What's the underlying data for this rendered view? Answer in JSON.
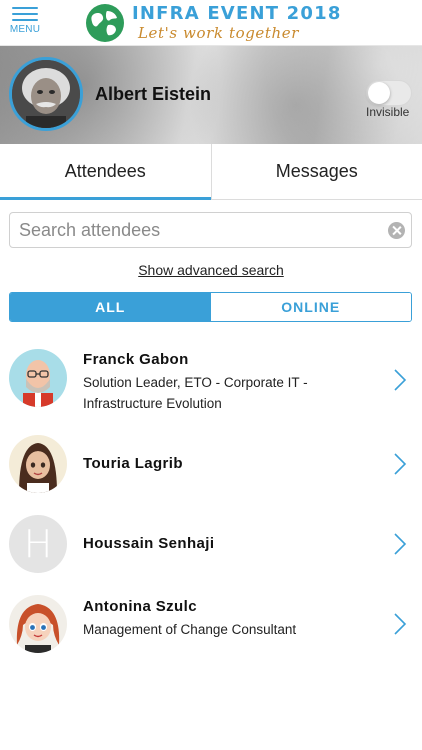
{
  "header": {
    "menu_label": "MENU",
    "brand_title": "INFRA EVENT 2018",
    "brand_tagline": "Let's work together"
  },
  "profile": {
    "name": "Albert Eistein",
    "visibility_label": "Invisible",
    "visible": false
  },
  "tabs": [
    {
      "label": "Attendees",
      "active": true
    },
    {
      "label": "Messages",
      "active": false
    }
  ],
  "search": {
    "placeholder": "Search attendees",
    "value": ""
  },
  "advanced_search_label": "Show advanced search",
  "filter": {
    "options": [
      "ALL",
      "ONLINE"
    ],
    "selected": "ALL"
  },
  "attendees": [
    {
      "name": "Franck Gabon",
      "subtitle": "Solution Leader, ETO - Corporate IT - Infrastructure Evolution",
      "avatar": "cartoon-bald-man"
    },
    {
      "name": "Touria Lagrib",
      "subtitle": "",
      "avatar": "cartoon-woman-dark-hair"
    },
    {
      "name": "Houssain Senhaji",
      "subtitle": "",
      "avatar": "initial",
      "initial": "H"
    },
    {
      "name": "Antonina Szulc",
      "subtitle": "Management of Change Consultant",
      "avatar": "cartoon-woman-red-hair"
    }
  ],
  "colors": {
    "accent": "#3aa0d8",
    "tagline": "#c98a2e",
    "globe": "#2e9c5a"
  }
}
